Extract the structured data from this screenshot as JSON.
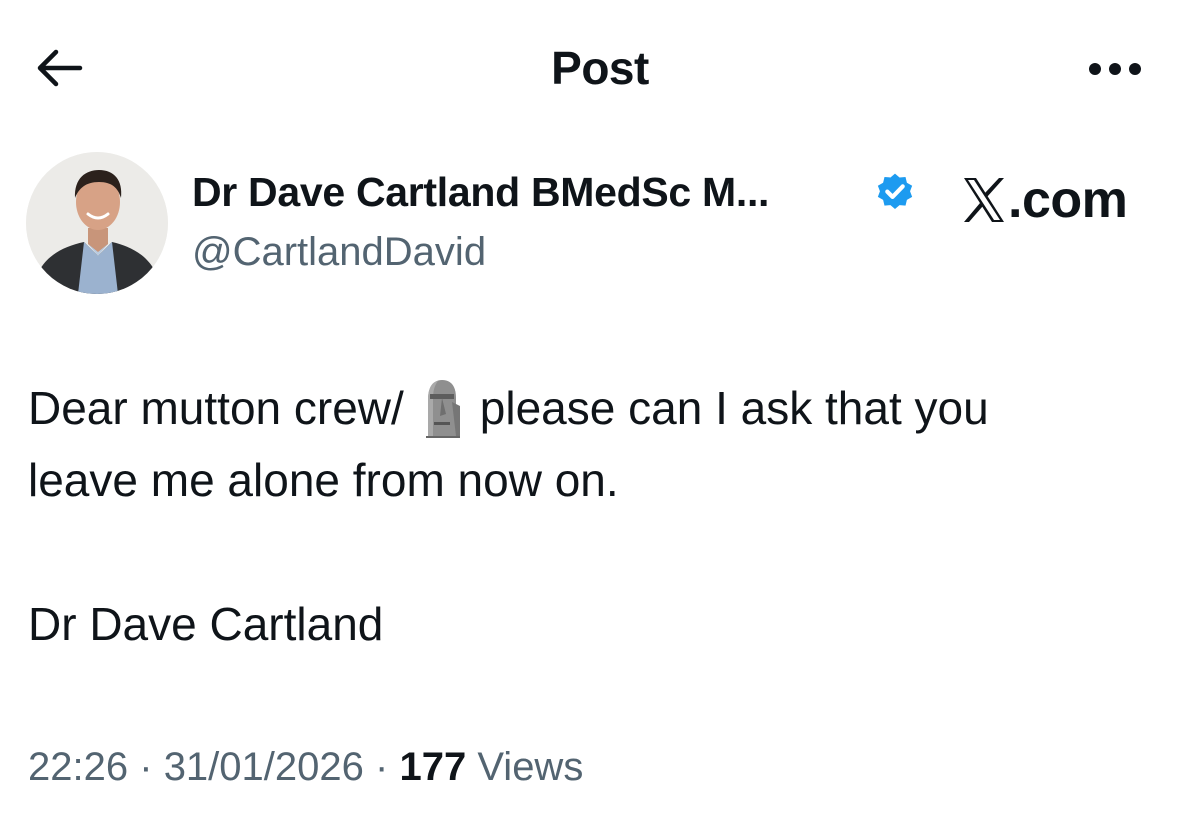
{
  "header": {
    "title": "Post",
    "back_icon": "arrow-left-icon",
    "more_icon": "more-horizontal-icon"
  },
  "author": {
    "display_name": "Dr Dave Cartland BMedSc M...",
    "handle": "@CartlandDavid",
    "verified": true,
    "verified_color": "#1d9bf0"
  },
  "brand": {
    "text": ".com",
    "icon": "x-logo-icon"
  },
  "post": {
    "line1_before": "Dear mutton crew/",
    "emoji": "moai-emoji",
    "line1_after": "please can I ask that you",
    "line2": "leave me alone from now on.",
    "signature": "Dr Dave Cartland"
  },
  "meta": {
    "time": "22:26",
    "separator": "·",
    "date": "31/01/2026",
    "views_count": "177",
    "views_label": "Views"
  },
  "colors": {
    "text_primary": "#0f1419",
    "text_secondary": "#536471",
    "background": "#ffffff"
  }
}
